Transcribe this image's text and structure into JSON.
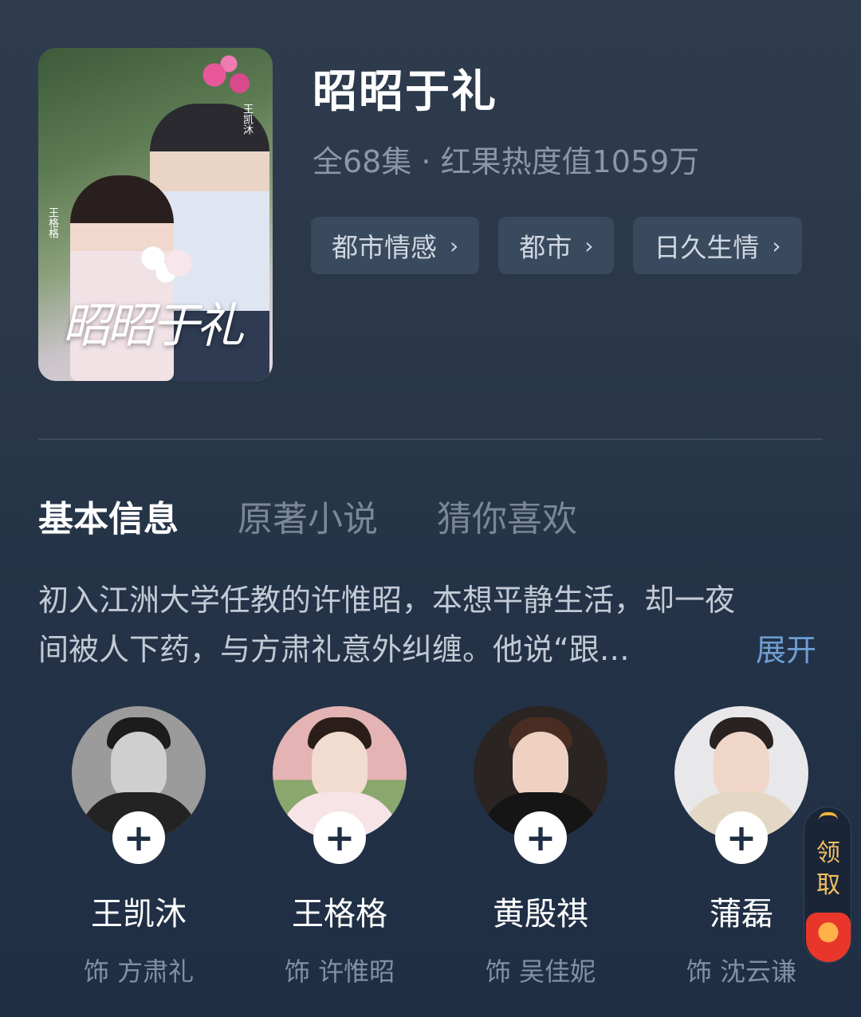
{
  "show": {
    "title": "昭昭于礼",
    "meta": "全68集 · 红果热度值1059万",
    "poster": {
      "logo_text": "昭昭于礼",
      "actor_label_1": "王凯沐",
      "actor_label_2": "王格格"
    },
    "tags": [
      {
        "label": "都市情感",
        "chevron": "›"
      },
      {
        "label": "都市",
        "chevron": "›"
      },
      {
        "label": "日久生情",
        "chevron": "›"
      }
    ]
  },
  "tabs": [
    {
      "label": "基本信息",
      "active": true
    },
    {
      "label": "原著小说",
      "active": false
    },
    {
      "label": "猜你喜欢",
      "active": false
    }
  ],
  "synopsis": {
    "line1": "初入江洲大学任教的许惟昭，本想平静生活，却一夜",
    "line2": "间被人下药，与方肃礼意外纠缠。他说“跟…",
    "expand_label": "展开"
  },
  "cast": [
    {
      "name": "王凯沐",
      "role": "饰 方肃礼",
      "plus": "+"
    },
    {
      "name": "王格格",
      "role": "饰 许惟昭",
      "plus": "+"
    },
    {
      "name": "黄殷祺",
      "role": "饰 吴佳妮",
      "plus": "+"
    },
    {
      "name": "蒲磊",
      "role": "饰 沈云谦",
      "plus": "+"
    }
  ],
  "float_badge": {
    "label": "领取"
  },
  "colors": {
    "background": "#2a3849",
    "tag_bg": "#3a4a5e",
    "expand": "#6e9fd6",
    "muted": "#8a97a8"
  }
}
